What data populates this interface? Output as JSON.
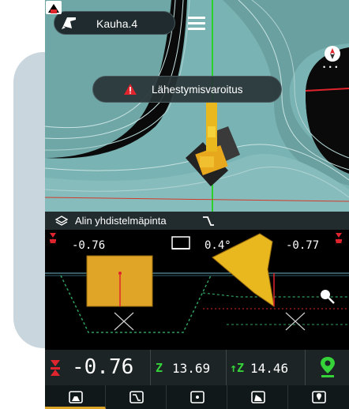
{
  "header": {
    "bucket_label": "Kauha.4"
  },
  "warning": {
    "text": "Lähestymisvaroitus"
  },
  "surface_bar": {
    "label": "Alin yhdistelmäpinta"
  },
  "profile": {
    "left_value": "-0.76",
    "slope_value": "0.4°",
    "right_value": "-0.77"
  },
  "readouts": {
    "depth": "-0.76",
    "z_label": "Z",
    "z_value": "13.69",
    "dz_label": "↑Z",
    "dz_value": "14.46"
  },
  "nav": {
    "tabs": [
      "front-view",
      "profile-view",
      "point-view",
      "side-view",
      "location-view"
    ]
  },
  "colors": {
    "accent": "#d8a326",
    "green": "#36d23a",
    "red": "#e0242d",
    "map_surface": "#7fb4b4"
  }
}
